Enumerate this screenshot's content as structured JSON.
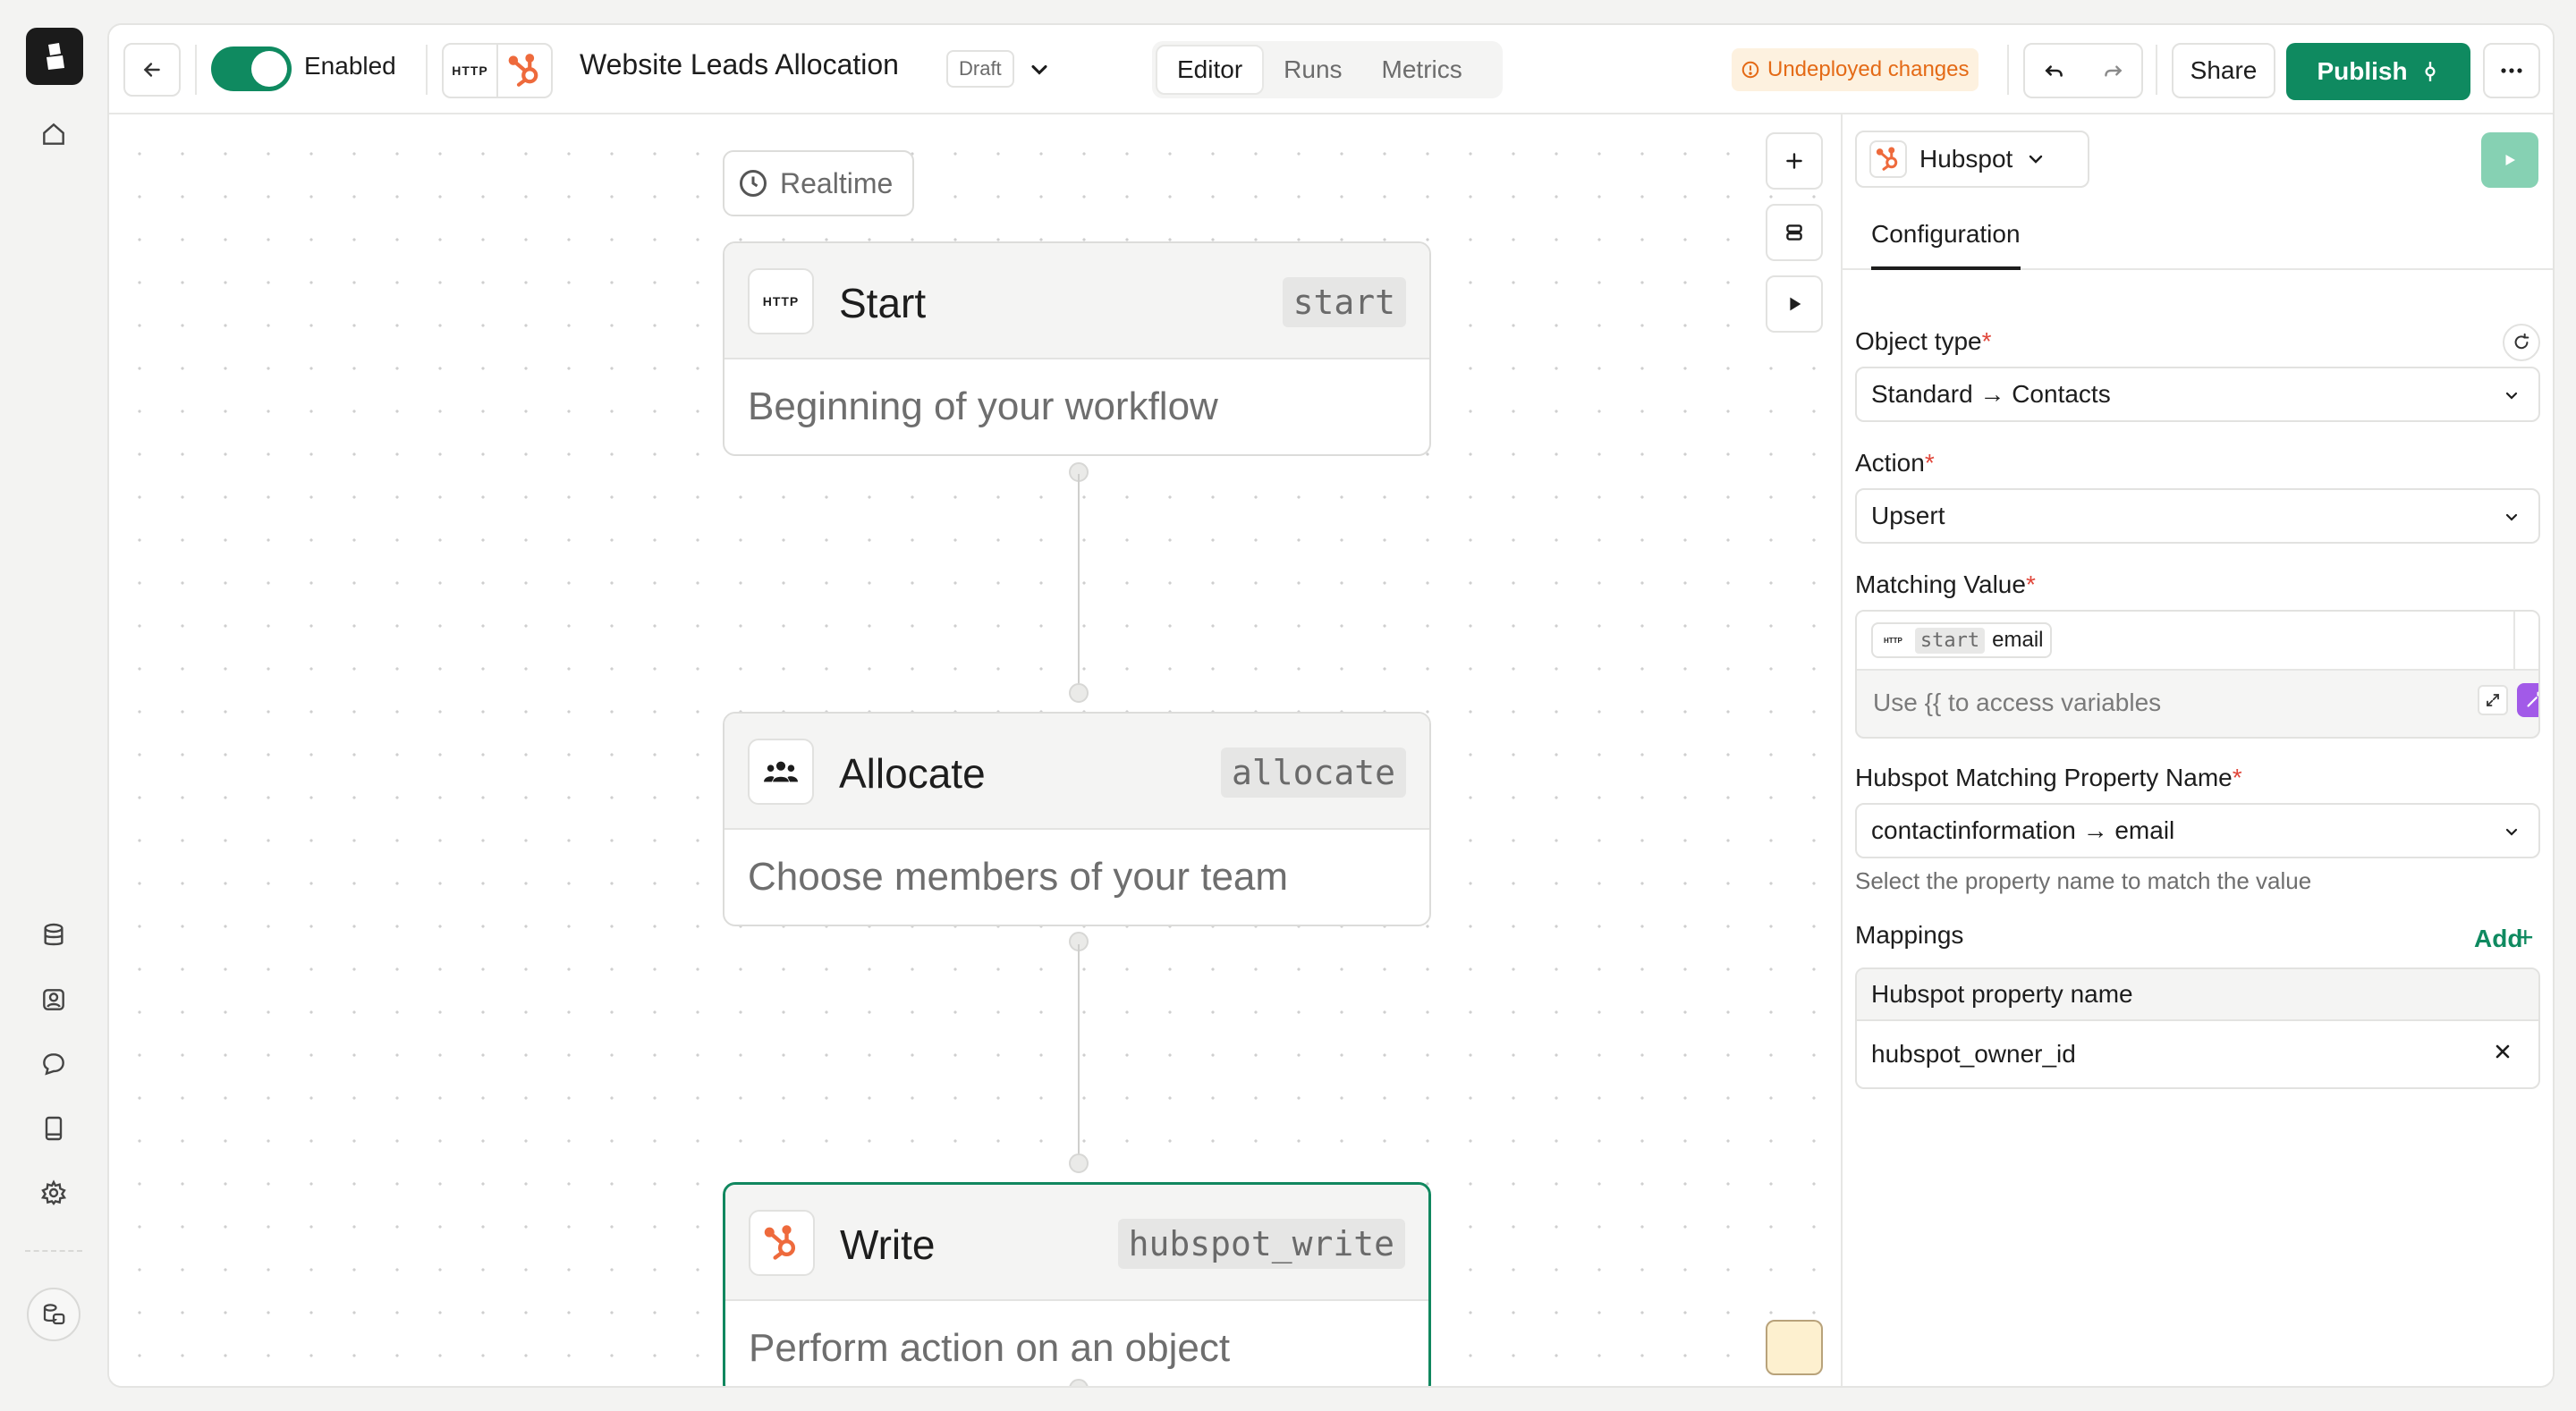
{
  "topbar": {
    "enabled_label": "Enabled",
    "http_label": "HTTP",
    "workflow_title": "Website Leads Allocation",
    "status_badge": "Draft",
    "tabs": [
      {
        "label": "Editor",
        "active": true
      },
      {
        "label": "Runs",
        "active": false
      },
      {
        "label": "Metrics",
        "active": false
      }
    ],
    "undeployed_label": "Undeployed changes",
    "share_label": "Share",
    "publish_label": "Publish"
  },
  "canvas": {
    "trigger_label": "Realtime",
    "nodes": [
      {
        "title": "Start",
        "id": "start",
        "description": "Beginning of your workflow",
        "icon": "http-icon"
      },
      {
        "title": "Allocate",
        "id": "allocate",
        "description": "Choose members of your team",
        "icon": "team-icon"
      },
      {
        "title": "Write",
        "id": "hubspot_write",
        "description": "Perform action on an object",
        "icon": "hubspot-icon"
      }
    ]
  },
  "panel": {
    "app_name": "Hubspot",
    "tab_label": "Configuration",
    "object_type": {
      "label": "Object type",
      "value": "Standard → Contacts"
    },
    "action": {
      "label": "Action",
      "value": "Upsert"
    },
    "matching_value": {
      "label": "Matching Value",
      "token_app": "HTTP",
      "token_id": "start",
      "token_field": "email",
      "placeholder": "Use {{ to access variables"
    },
    "matching_property": {
      "label": "Hubspot Matching Property Name",
      "value": "contactinformation → email",
      "hint": "Select the property name to match the value"
    },
    "mappings": {
      "label": "Mappings",
      "add_label": "Add",
      "column": "Hubspot property name",
      "rows": [
        "hubspot_owner_id"
      ]
    }
  },
  "colors": {
    "accent": "#0f8a60",
    "warning": "#e46a16",
    "hubspot": "#ee6a3c",
    "magic": "#a25ae8"
  }
}
